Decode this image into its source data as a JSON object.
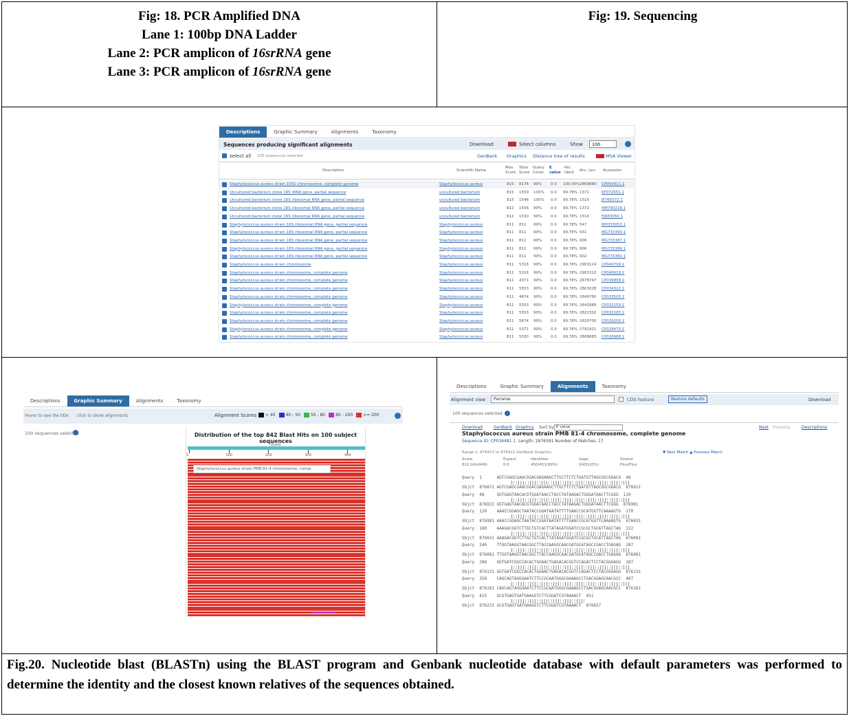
{
  "fig18": {
    "line1": "Fig: 18. PCR Amplified DNA",
    "line2": "Lane 1: 100bp DNA Ladder",
    "line3_prefix": "Lane 2: PCR amplicon of ",
    "line3_gene": "16srRNA",
    "line3_suffix": " gene",
    "line4_prefix": "Lane 3: PCR amplicon of ",
    "line4_gene": "16srRNA",
    "line4_suffix": " gene"
  },
  "fig19": {
    "title": "Fig: 19. Sequencing"
  },
  "caption": "Fig.20. Nucleotide blast (BLASTn) using the BLAST program and Genbank nucleotide database with default parameters was performed to determine the identity and the closest known relatives of the sequences obtained.",
  "blast_desc": {
    "tabs": [
      "Descriptions",
      "Graphic Summary",
      "Alignments",
      "Taxonomy"
    ],
    "heading": "Sequences producing significant alignments",
    "download": "Download",
    "select_columns": "Select columns",
    "show_label": "Show",
    "show_value": "100",
    "select_all": "select all",
    "selected_count": "100 sequences selected",
    "links": [
      "GenBank",
      "Graphics",
      "Distance tree of results",
      "MSA Viewer"
    ],
    "columns": [
      "Description",
      "Scientific Name",
      "Max Score",
      "Total Score",
      "Query Cover",
      "E value",
      "Per. Ident",
      "Acc. Len",
      "Accession"
    ],
    "rows": [
      {
        "desc": "Staphylococcus aureus strain 1551 chromosome, complete genome",
        "sci": "Staphylococcus aureus",
        "max": "815",
        "total": "8174",
        "cover": "99%",
        "e": "0.0",
        "ident": "100.00%",
        "len": "2869680",
        "acc": "CP050411.1"
      },
      {
        "desc": "Uncultured bacterium clone 16S rRNA gene, partial sequence",
        "sci": "uncultured bacterium",
        "max": "815",
        "total": "1550",
        "cover": "100%",
        "e": "0.0",
        "ident": "99.78%",
        "len": "1372",
        "acc": "KF072551.1"
      },
      {
        "desc": "Uncultured bacterium clone 16S ribosomal RNA gene, partial sequence",
        "sci": "uncultured bacterium",
        "max": "815",
        "total": "1546",
        "cover": "100%",
        "e": "0.0",
        "ident": "99.78%",
        "len": "1510",
        "acc": "JF765572.1"
      },
      {
        "desc": "Uncultured bacterium clone 16S ribosomal RNA gene, partial sequence",
        "sci": "uncultured bacterium",
        "max": "812",
        "total": "1556",
        "cover": "99%",
        "e": "0.0",
        "ident": "99.78%",
        "len": "1372",
        "acc": "HM790218.1"
      },
      {
        "desc": "Uncultured bacterium clone 16S ribosomal RNA gene, partial sequence",
        "sci": "uncultured bacterium",
        "max": "812",
        "total": "1530",
        "cover": "99%",
        "e": "0.0",
        "ident": "99.78%",
        "len": "1510",
        "acc": "FJ683050.1"
      },
      {
        "desc": "Staphylococcus aureus strain 16S ribosomal RNA gene, partial sequence",
        "sci": "Staphylococcus aureus",
        "max": "811",
        "total": "811",
        "cover": "99%",
        "e": "0.0",
        "ident": "99.78%",
        "len": "547",
        "acc": "MH333053.1"
      },
      {
        "desc": "Staphylococcus aureus strain 16S ribosomal RNA gene, partial sequence",
        "sci": "Staphylococcus aureus",
        "max": "811",
        "total": "811",
        "cover": "99%",
        "e": "0.0",
        "ident": "99.78%",
        "len": "931",
        "acc": "MG733390.1"
      },
      {
        "desc": "Staphylococcus aureus strain 16S ribosomal RNA gene, partial sequence",
        "sci": "Staphylococcus aureus",
        "max": "811",
        "total": "811",
        "cover": "99%",
        "e": "0.0",
        "ident": "99.78%",
        "len": "906",
        "acc": "MG733387.1"
      },
      {
        "desc": "Staphylococcus aureus strain 16S ribosomal RNA gene, partial sequence",
        "sci": "Staphylococcus aureus",
        "max": "811",
        "total": "811",
        "cover": "99%",
        "e": "0.0",
        "ident": "99.78%",
        "len": "906",
        "acc": "MG733386.1"
      },
      {
        "desc": "Staphylococcus aureus strain 16S ribosomal RNA gene, partial sequence",
        "sci": "Staphylococcus aureus",
        "max": "811",
        "total": "811",
        "cover": "99%",
        "e": "0.0",
        "ident": "99.78%",
        "len": "902",
        "acc": "MG733382.1"
      },
      {
        "desc": "Staphylococcus aureus strain chromosome",
        "sci": "Staphylococcus aureus",
        "max": "811",
        "total": "5316",
        "cover": "99%",
        "e": "0.0",
        "ident": "99.78%",
        "len": "2903124",
        "acc": "CP040799.1"
      },
      {
        "desc": "Staphylococcus aureus strain chromosome, complete genome",
        "sci": "Staphylococcus aureus",
        "max": "811",
        "total": "5316",
        "cover": "99%",
        "e": "0.0",
        "ident": "99.78%",
        "len": "2903310",
        "acc": "CP040619.1"
      },
      {
        "desc": "Staphylococcus aureus strain chromosome, complete genome",
        "sci": "Staphylococcus aureus",
        "max": "811",
        "total": "4371",
        "cover": "99%",
        "e": "0.0",
        "ident": "99.78%",
        "len": "2878747",
        "acc": "CP036858.1"
      },
      {
        "desc": "Staphylococcus aureus strain chromosome, complete genome",
        "sci": "Staphylococcus aureus",
        "max": "811",
        "total": "5553",
        "cover": "99%",
        "e": "0.0",
        "ident": "99.78%",
        "len": "2803028",
        "acc": "CP034322.1"
      },
      {
        "desc": "Staphylococcus aureus strain chromosome, complete genome",
        "sci": "Staphylococcus aureus",
        "max": "811",
        "total": "4874",
        "cover": "99%",
        "e": "0.0",
        "ident": "99.78%",
        "len": "2849780",
        "acc": "CP033505.1"
      },
      {
        "desc": "Staphylococcus aureus strain chromosome, complete genome",
        "sci": "Staphylococcus aureus",
        "max": "811",
        "total": "5553",
        "cover": "99%",
        "e": "0.0",
        "ident": "99.78%",
        "len": "2842889",
        "acc": "CP032159.1"
      },
      {
        "desc": "Staphylococcus aureus strain chromosome, complete genome",
        "sci": "Staphylococcus aureus",
        "max": "811",
        "total": "5553",
        "cover": "99%",
        "e": "0.0",
        "ident": "99.78%",
        "len": "2822302",
        "acc": "CP032165.1"
      },
      {
        "desc": "Staphylococcus aureus strain chromosome, complete genome",
        "sci": "Staphylococcus aureus",
        "max": "811",
        "total": "5874",
        "cover": "99%",
        "e": "0.0",
        "ident": "99.78%",
        "len": "2829700",
        "acc": "CP029200.1"
      },
      {
        "desc": "Staphylococcus aureus strain chromosome, complete genome",
        "sci": "Staphylococcus aureus",
        "max": "811",
        "total": "5071",
        "cover": "99%",
        "e": "0.0",
        "ident": "99.78%",
        "len": "2791921",
        "acc": "CP028470.1"
      },
      {
        "desc": "Staphylococcus aureus strain chromosome, complete genome",
        "sci": "Staphylococcus aureus",
        "max": "811",
        "total": "5330",
        "cover": "99%",
        "e": "0.0",
        "ident": "99.78%",
        "len": "2808685",
        "acc": "CP026968.1"
      }
    ]
  },
  "blast_graph": {
    "tabs": [
      "Descriptions",
      "Graphic Summary",
      "Alignments",
      "Taxonomy"
    ],
    "hover_note": "Hover to see the title",
    "click_note": "click to show alignments",
    "score_label": "Alignment Scores",
    "legend": [
      {
        "label": "< 40",
        "color": "#111111"
      },
      {
        "label": "40 - 50",
        "color": "#2233cc"
      },
      {
        "label": "50 - 80",
        "color": "#33bb44"
      },
      {
        "label": "80 - 200",
        "color": "#bb33bb"
      },
      {
        "label": ">= 200",
        "color": "#d9322b"
      }
    ],
    "selected": "100 sequences selected",
    "title": "Distribution of the top 842 Blast Hits on 100 subject sequences",
    "query_label": "Query",
    "ticks": [
      "1",
      "100",
      "200",
      "300",
      "400"
    ],
    "tooltip": "Staphylococcus aureus strain PMB 81-4 chromosome, compl."
  },
  "blast_aln": {
    "tabs": [
      "Descriptions",
      "Graphic Summary",
      "Alignments",
      "Taxonomy"
    ],
    "view_label": "Alignment view",
    "view_value": "Pairwise",
    "cds_label": "CDS feature",
    "restore": "Restore defaults",
    "download": "Download",
    "selected": "100 sequences selected",
    "sub_links": [
      "Download",
      "GenBank",
      "Graphics",
      "Sort by:",
      "E value"
    ],
    "nav_links": [
      "Next",
      "Previous",
      "Descriptions"
    ],
    "hit_title": "Staphylococcus aureus strain PMB 81-4 chromosome, complete genome",
    "seq_id": "Sequence ID: CP034481.1",
    "len_info": "Length: 2876591   Number of Matches: 17",
    "range": "Range 1: 876472 to 876911  GenBank  Graphics",
    "next_match": "▼ Next Match  ▲ Previous Match",
    "stats_head": [
      "Score",
      "Expect",
      "Identities",
      "Gaps",
      "Strand"
    ],
    "stats_vals": [
      "811 bits(449)",
      "0.0",
      "450/451(99%)",
      "0/451(0%)",
      "Plus/Plus"
    ],
    "lines": [
      {
        "q": "Query  1      AGTCGAGCGAACGGACGAGAAGCTTGCTTCTCTGATGTTAGCGGCGGACG  48",
        "s": "Sbjct  876872 AGTCGAGCGAACGGACGAGAAGCTTGCTTCTCTGATGTTAGCGGCGGACG  876911"
      },
      {
        "q": "Query  48     GGTGAGTAACACGTGGATAACCTACCTATAAGACTGGGATAACTTCGGG  110",
        "s": "Sbjct  876922 GGTGAGTAACACGTGGATAACCTACCTATAAGACTGGGATAACTTCGGG  876981"
      },
      {
        "q": "Query  120    AAACCGGAGCTAATACCGGATAATATTTTGAACCGCATGGTTCAAAAGTG  170",
        "s": "Sbjct  876981 AAACCGGAGCTAATACCGGATAATATTTTGAACCGCATGGTTCAAAAGTG  876031"
      },
      {
        "q": "Query  180    AAAGACGGTCTTGCTGTCACTTATAGATGGATCCGCGCTGCATTAGCTAG  222",
        "s": "Sbjct  876031 AAAGACGGTCTTGCTGTCACTTATAGATGGATCCGCGCTGCATTAGCTAG  876081"
      },
      {
        "q": "Query  240    TTGGTAAGGTAACGGCTTACCAAGGCAACGATGCATAGCCGACCTGAGAG  287",
        "s": "Sbjct  876081 TTGGTAAGGTAACGGCTTACCAAGGCAACGATGCATAGCCGACCTGAGAG  876081"
      },
      {
        "q": "Query  286    GGTGATCGGCCACACTGGAACTGAGACACGGTCCAGACTCCTACGGGAGG  287",
        "s": "Sbjct  876131 GGTGATCGGCCACACTGGAACTGAGACACGGTCCAGACTCCTACGGGAGG  876131"
      },
      {
        "q": "Query  358    CAGCAGTAGGGAATCTTCCGCAATGGGCGAAAGCCTGACGGAGCAACGCC  407",
        "s": "Sbjct  876181 CAGCAGTAGGGAATCTTCCGCAATGGGCGAAAGCCTGACGGAGCAACGCC  876181"
      },
      {
        "q": "Query  415    GCGTGAGTGATGAAGGTCTTCGGATCGTAAAACT  451",
        "s": "Sbjct  876231 GCGTGAGTGATGAAGGTCTTCGGATCGTAAAACT  876657"
      }
    ]
  }
}
